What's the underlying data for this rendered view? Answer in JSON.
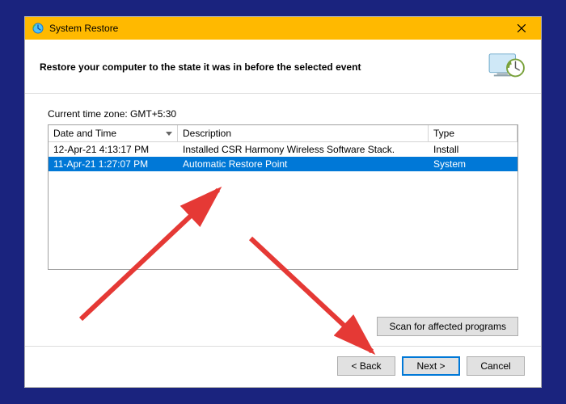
{
  "window": {
    "title": "System Restore",
    "heading": "Restore your computer to the state it was in before the selected event"
  },
  "timezone_label": "Current time zone: GMT+5:30",
  "columns": {
    "date": "Date and Time",
    "desc": "Description",
    "type": "Type"
  },
  "rows": [
    {
      "date": "12-Apr-21 4:13:17 PM",
      "desc": "Installed CSR Harmony Wireless Software Stack.",
      "type": "Install",
      "selected": false
    },
    {
      "date": "11-Apr-21 1:27:07 PM",
      "desc": "Automatic Restore Point",
      "type": "System",
      "selected": true
    }
  ],
  "buttons": {
    "scan": "Scan for affected programs",
    "back": "< Back",
    "next": "Next >",
    "cancel": "Cancel"
  }
}
